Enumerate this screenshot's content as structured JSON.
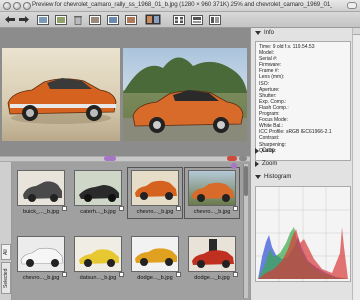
{
  "window": {
    "title": "Preview for chevrolet_camaro_rally_ss_1968_01_b.jpg (1280 × 960 371K) 25% and chevrolet_camaro_1969_01_b.jpg (1280 × 960"
  },
  "toolbar": {
    "icons": [
      "back-arrow-icon",
      "forward-arrow-icon",
      "image-icon",
      "image-icon",
      "trash-icon",
      "image-icon",
      "image-icon",
      "image-icon",
      "compare-icon",
      "grid-icon",
      "layout-icon",
      "layout-icon"
    ]
  },
  "sidebar": {
    "info_label": "Info",
    "info_lines": [
      "Time: 9 old f.v. 119.54.53",
      "Model:",
      "Serial #:",
      "Firmware:",
      "Frame #:",
      "Lens (mm):",
      "ISO:",
      "Aperture:",
      "Shutter:",
      "Exp. Comp.:",
      "Flash Comp.:",
      "Program:",
      "Focus Mode:",
      "White Bal.:",
      "ICC Profile: sRGB IEC61966-2.1",
      "Contrast:",
      "Sharpening:",
      "Quality:"
    ],
    "crop_label": "Crop",
    "zoom_label": "Zoom",
    "histogram_label": "Histogram"
  },
  "side_tabs": {
    "all": "All",
    "selected": "Selected"
  },
  "thumbnails": [
    {
      "caption": "buick_..._b.jpg"
    },
    {
      "caption": "caterh..._b.jpg"
    },
    {
      "caption": "chevro..._b.jpg"
    },
    {
      "caption": "chevro..._b.jpg"
    },
    {
      "caption": "chevro..._b.jpg"
    },
    {
      "caption": "datsun..._b.jpg"
    },
    {
      "caption": "dodge..._b.jpg"
    },
    {
      "caption": "dodge..._b.jpg"
    }
  ],
  "colors": {
    "selection_purple": "#a874c8",
    "label_red": "#d04a3a",
    "car_orange": "#d5621e"
  }
}
